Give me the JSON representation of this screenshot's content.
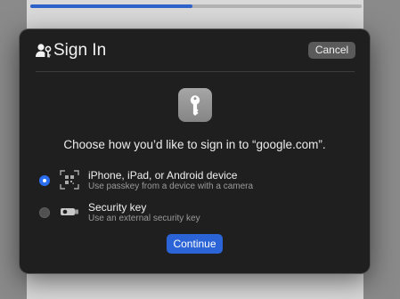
{
  "background": {
    "progress_fraction": 0.49,
    "accent_color": "#2f63c9"
  },
  "dialog": {
    "title": "Sign In",
    "title_icon": "person-key-icon",
    "cancel_label": "Cancel",
    "hero_icon": "key-icon",
    "prompt": "Choose how you’d like to sign in to “google.com”.",
    "options": [
      {
        "title": "iPhone, iPad, or Android device",
        "subtitle": "Use passkey from a device with a camera",
        "icon": "qr-code-icon",
        "selected": true
      },
      {
        "title": "Security key",
        "subtitle": "Use an external security key",
        "icon": "security-key-icon",
        "selected": false
      }
    ],
    "continue_label": "Continue",
    "button_color": "#2a64d6"
  }
}
